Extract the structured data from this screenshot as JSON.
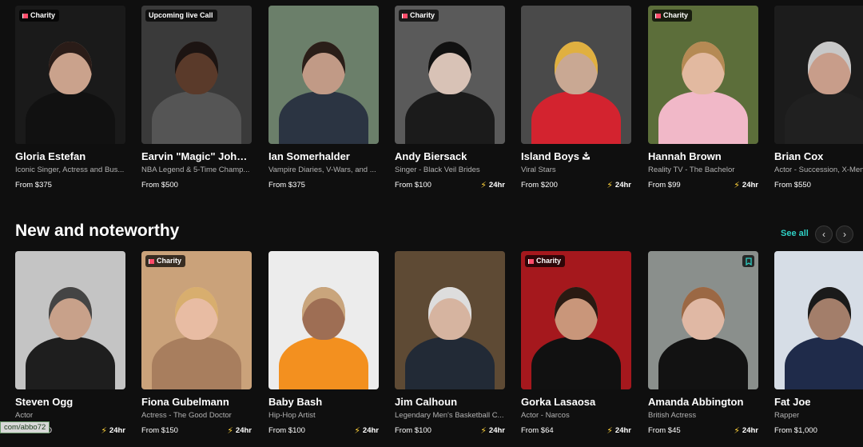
{
  "row1": [
    {
      "name": "Gloria Estefan",
      "desc": "Iconic Singer, Actress and Bus...",
      "price": "From $375",
      "badge": "Charity",
      "fast": "",
      "bg": "#1a1a1a",
      "skin": "#caa28c",
      "hair": "#2a1c18",
      "cloth": "#111111"
    },
    {
      "name": "Earvin \"Magic\" Johnson",
      "desc": "NBA Legend & 5-Time Champ...",
      "price": "From $500",
      "badge": "Upcoming live Call",
      "fast": "",
      "bg": "#3a3a3a",
      "skin": "#5a3a2a",
      "hair": "#1c1412",
      "cloth": "#555555"
    },
    {
      "name": "Ian Somerhalder",
      "desc": "Vampire Diaries, V-Wars, and ...",
      "price": "From $375",
      "badge": "",
      "fast": "",
      "bg": "#6b7f6a",
      "skin": "#c19a86",
      "hair": "#2a1e18",
      "cloth": "#2b3442"
    },
    {
      "name": "Andy Biersack",
      "desc": "Singer - Black Veil Brides",
      "price": "From $100",
      "badge": "Charity",
      "fast": "24hr",
      "bg": "#5a5a5a",
      "skin": "#d8c2b6",
      "hair": "#111111",
      "cloth": "#1b1b1b"
    },
    {
      "name": "Island Boys",
      "desc": "Viral Stars",
      "price": "From $200",
      "badge": "",
      "fast": "24hr",
      "bg": "#4a4a4a",
      "skin": "#c9a893",
      "hair": "#e0b040",
      "cloth": "#d3232f"
    },
    {
      "name": "Hannah Brown",
      "desc": "Reality TV - The Bachelor",
      "price": "From $99",
      "badge": "Charity",
      "fast": "24hr",
      "bg": "#5c6e3a",
      "skin": "#e2b9a0",
      "hair": "#b58a54",
      "cloth": "#f1b8c8"
    },
    {
      "name": "Brian Cox",
      "desc": "Actor - Succession, X-Men",
      "price": "From $550",
      "badge": "",
      "fast": "",
      "bg": "#1c1c1c",
      "skin": "#c89d8a",
      "hair": "#c8c8c8",
      "cloth": "#202020"
    }
  ],
  "section": {
    "title": "New and noteworthy",
    "see_all": "See all"
  },
  "row2": [
    {
      "name": "Steven Ogg",
      "desc": "Actor",
      "price": "From $130",
      "badge": "",
      "fast": "24hr",
      "bookmark": false,
      "bg": "#c4c4c4",
      "skin": "#c8a18a",
      "hair": "#444444",
      "cloth": "#1e1e1e"
    },
    {
      "name": "Fiona Gubelmann",
      "desc": "Actress - The Good Doctor",
      "price": "From $150",
      "badge": "Charity",
      "fast": "24hr",
      "bookmark": false,
      "bg": "#caa27a",
      "skin": "#e8bca3",
      "hair": "#d8ae6e",
      "cloth": "#a87e5e"
    },
    {
      "name": "Baby Bash",
      "desc": "Hip-Hop Artist",
      "price": "From $100",
      "badge": "",
      "fast": "24hr",
      "bookmark": false,
      "bg": "#ececec",
      "skin": "#9e6e54",
      "hair": "#c9a57c",
      "cloth": "#f3901f"
    },
    {
      "name": "Jim Calhoun",
      "desc": "Legendary Men's Basketball C...",
      "price": "From $100",
      "badge": "",
      "fast": "24hr",
      "bookmark": false,
      "bg": "#5e4a34",
      "skin": "#d6b4a0",
      "hair": "#dddddd",
      "cloth": "#222a36"
    },
    {
      "name": "Gorka Lasaosa",
      "desc": "Actor - Narcos",
      "price": "From $64",
      "badge": "Charity",
      "fast": "24hr",
      "bookmark": false,
      "bg": "#a5181d",
      "skin": "#c9967a",
      "hair": "#2a1a12",
      "cloth": "#111111"
    },
    {
      "name": "Amanda Abbington",
      "desc": "British Actress",
      "price": "From $45",
      "badge": "",
      "fast": "24hr",
      "bookmark": true,
      "bg": "#8a8f8c",
      "skin": "#e0b8a4",
      "hair": "#9b6844",
      "cloth": "#121212"
    },
    {
      "name": "Fat Joe",
      "desc": "Rapper",
      "price": "From $1,000",
      "badge": "",
      "fast": "",
      "bookmark": false,
      "bg": "#d6dde6",
      "skin": "#a37e6a",
      "hair": "#1a1a1a",
      "cloth": "#1f2b4a"
    }
  ],
  "status_bar": {
    "url": "com/abbo72"
  }
}
